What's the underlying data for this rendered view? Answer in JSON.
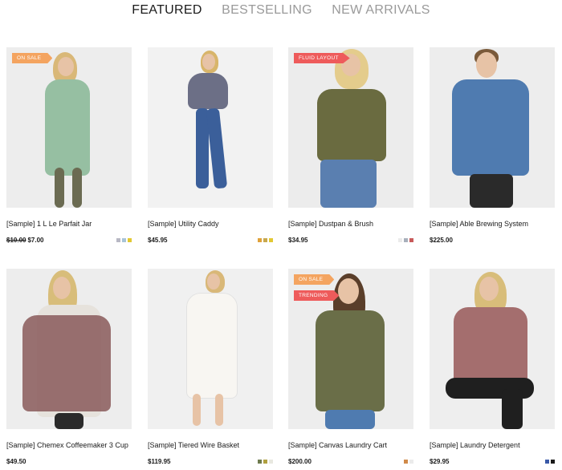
{
  "tabs": [
    {
      "label": "FEATURED"
    },
    {
      "label": "BESTSELLING"
    },
    {
      "label": "NEW ARRIVALS"
    }
  ],
  "products": [
    {
      "name": "[Sample] 1 L Le Parfait Jar",
      "old_price": "$10.00",
      "price": "$7.00",
      "badges": [
        "ON SALE"
      ],
      "swatches": [
        "#b8b8c4",
        "#a8c4d8",
        "#e2c832"
      ]
    },
    {
      "name": "[Sample] Utility Caddy",
      "old_price": "",
      "price": "$45.95",
      "badges": [],
      "swatches": [
        "#e0a23a",
        "#c8a84e",
        "#e2c832"
      ]
    },
    {
      "name": "[Sample] Dustpan & Brush",
      "old_price": "",
      "price": "$34.95",
      "badges": [
        "FLUID LAYOUT"
      ],
      "swatches": [
        "#ebebeb",
        "#a8b0bc",
        "#c85a5a"
      ]
    },
    {
      "name": "[Sample] Able Brewing System",
      "old_price": "",
      "price": "$225.00",
      "badges": [],
      "swatches": []
    },
    {
      "name": "[Sample] Chemex Coffeemaker 3 Cup",
      "old_price": "",
      "price": "$49.50",
      "badges": [],
      "swatches": []
    },
    {
      "name": "[Sample] Tiered Wire Basket",
      "old_price": "",
      "price": "$119.95",
      "badges": [],
      "swatches": [
        "#6e7b4e",
        "#b0a040",
        "#e8e8e0"
      ]
    },
    {
      "name": "[Sample] Canvas Laundry Cart",
      "old_price": "",
      "price": "$200.00",
      "badges": [
        "ON SALE",
        "TRENDING"
      ],
      "swatches": [
        "#d08a4a",
        "#ebebeb"
      ]
    },
    {
      "name": "[Sample] Laundry Detergent",
      "old_price": "",
      "price": "$29.95",
      "badges": [],
      "swatches": [
        "#3a5aa8",
        "#1a1a1a"
      ]
    }
  ]
}
